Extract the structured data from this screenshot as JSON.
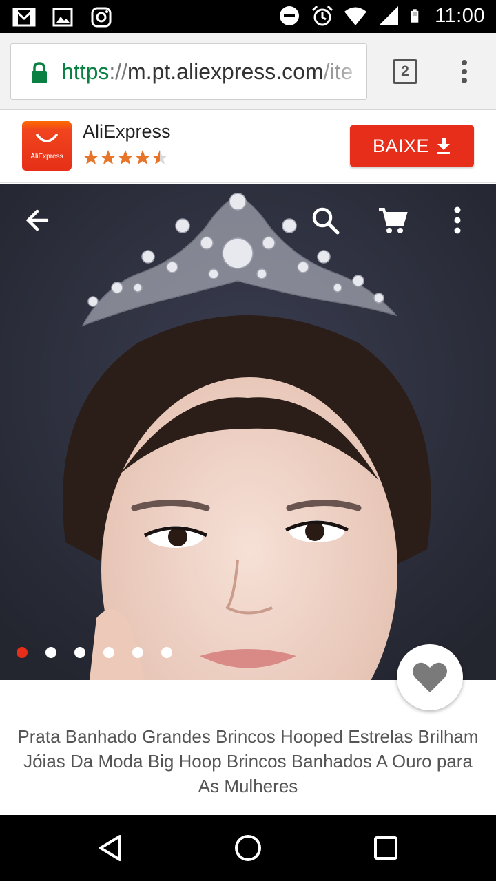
{
  "status_bar": {
    "time": "11:00",
    "left_icons": [
      "gmail-icon",
      "gallery-icon",
      "instagram-icon"
    ],
    "right_icons": [
      "do-not-disturb-icon",
      "alarm-icon",
      "wifi-icon",
      "signal-icon",
      "battery-icon"
    ]
  },
  "browser": {
    "url_scheme": "https",
    "url_separator": "://",
    "url_host": "m.pt.aliexpress.com",
    "url_path": "/ite",
    "tab_count": "2",
    "secure_color": "#0b8043"
  },
  "app_banner": {
    "app_name": "AliExpress",
    "logo_text": "AliExpress",
    "rating": 4.5,
    "install_label": "BAIXE",
    "accent": "#e62e1a"
  },
  "product": {
    "image_count": 6,
    "active_image": 0,
    "title": "Prata Banhado Grandes Brincos Hooped Estrelas Brilham Jóias Da Moda Big Hoop Brincos Banhados A Ouro para As Mulheres"
  }
}
